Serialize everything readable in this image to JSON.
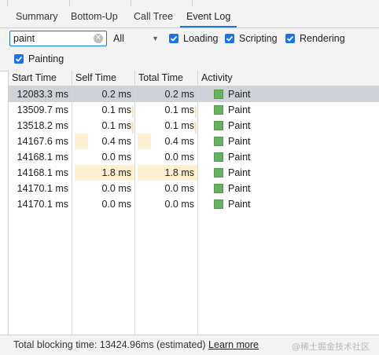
{
  "tabs": [
    {
      "label": "Summary"
    },
    {
      "label": "Bottom-Up"
    },
    {
      "label": "Call Tree"
    },
    {
      "label": "Event Log"
    }
  ],
  "active_tab": "Event Log",
  "filter": {
    "search_value": "paint",
    "category_select": "All",
    "checkboxes": [
      {
        "label": "Loading",
        "checked": true
      },
      {
        "label": "Scripting",
        "checked": true
      },
      {
        "label": "Rendering",
        "checked": true
      },
      {
        "label": "Painting",
        "checked": true
      }
    ]
  },
  "grid": {
    "columns": [
      "Start Time",
      "Self Time",
      "Total Time",
      "Activity"
    ],
    "rows": [
      {
        "start": "12083.3 ms",
        "self": "0.2 ms",
        "total": "0.2 ms",
        "activity": "Paint",
        "selected": true
      },
      {
        "start": "13509.7 ms",
        "self": "0.1 ms",
        "total": "0.1 ms",
        "activity": "Paint"
      },
      {
        "start": "13518.2 ms",
        "self": "0.1 ms",
        "total": "0.1 ms",
        "activity": "Paint"
      },
      {
        "start": "14167.6 ms",
        "self": "0.4 ms",
        "total": "0.4 ms",
        "activity": "Paint"
      },
      {
        "start": "14168.1 ms",
        "self": "0.0 ms",
        "total": "0.0 ms",
        "activity": "Paint"
      },
      {
        "start": "14168.1 ms",
        "self": "1.8 ms",
        "total": "1.8 ms",
        "activity": "Paint"
      },
      {
        "start": "14170.1 ms",
        "self": "0.0 ms",
        "total": "0.0 ms",
        "activity": "Paint"
      },
      {
        "start": "14170.1 ms",
        "self": "0.0 ms",
        "total": "0.0 ms",
        "activity": "Paint"
      }
    ]
  },
  "footer": {
    "text": "Total blocking time: 13424.96ms (estimated)",
    "link": "Learn more"
  },
  "watermark": "@稀土掘金技术社区",
  "colors": {
    "accent": "#1a73e8",
    "paint_category": "#66b260",
    "selected_row": "#cfd2d6",
    "time_bar": "#fdf0d2"
  }
}
